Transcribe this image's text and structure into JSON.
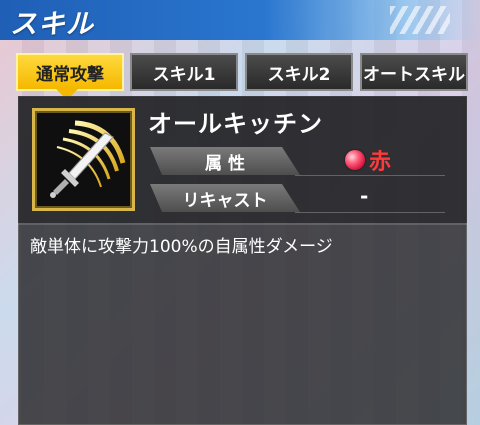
{
  "header": {
    "title": "スキル"
  },
  "tabs": [
    {
      "label": "通常攻撃",
      "active": true
    },
    {
      "label": "スキル1",
      "active": false
    },
    {
      "label": "スキル2",
      "active": false
    },
    {
      "label": "オートスキル",
      "active": false
    }
  ],
  "skill": {
    "icon": "sword-slash-icon",
    "name": "オールキッチン",
    "attribute_label": "属 性",
    "attribute_value": "赤",
    "attribute_orb_icon": "red-element-orb-icon",
    "recast_label": "リキャスト",
    "recast_value": "-",
    "description": "敵単体に攻撃力100%の自属性ダメージ"
  },
  "colors": {
    "header": "#2a76cf",
    "tab_active": "#f5b800",
    "tab_inactive": "#3a3a3a",
    "attribute_red": "#ff3a3a",
    "icon_border": "#d8b64a"
  }
}
